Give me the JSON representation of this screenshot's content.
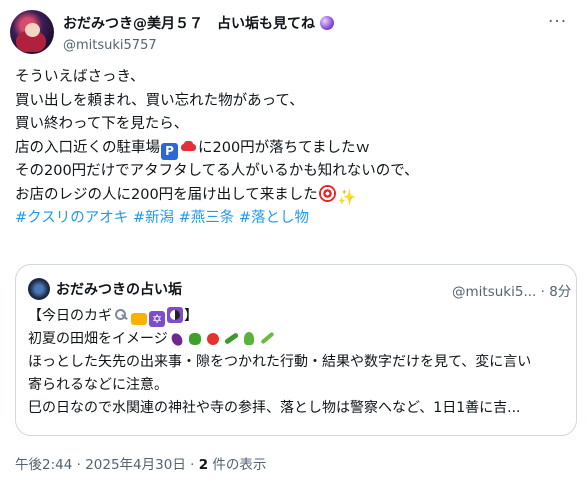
{
  "post": {
    "display_name": "おだみつき@美月５７　占い垢も見てね",
    "handle": "@mitsuki5757",
    "more_label": "···",
    "lines": [
      "そういえばさっき、",
      "買い出しを頼まれ、買い忘れた物があって、",
      "買い終わって下を見たら、",
      "に200円が落ちてましたｗ",
      "その200円だけでアタフタしてる人がいるかも知れないので、",
      "お店のレジの人に200円を届け出して来ました"
    ],
    "line4_prefix": "店の入口近くの駐車場",
    "parking_glyph": "P",
    "hashtags": "#クスリのアオキ #新潟 #燕三条 #落とし物"
  },
  "quote": {
    "name": "おだみつきの占い垢",
    "meta": "@mitsuki5... · 8分",
    "line1_prefix": "【今日のカギ",
    "line1_suffix": "】",
    "line2": "初夏の田畑をイメージ",
    "line3": "ほっとした矢先の出来事・隙をつかれた行動・結果や数字だけを見て、変に言い",
    "line4": "寄られるなどに注意。",
    "line5": "巳の日なので水関連の神社や寺の参拝、落とし物は警察へなど、1日1善に吉..."
  },
  "footer": {
    "timestamp": "午後2:44 · 2025年4月30日 · ",
    "views_count": "2",
    "views_label": " 件の表示"
  },
  "icons": [
    "crystal-ball-icon",
    "parking-icon",
    "car-icon",
    "target-icon",
    "sparkles-icon",
    "key-icon",
    "lock-icon",
    "star-of-david-icon",
    "yin-yang-icon",
    "eggplant-icon",
    "pepper-icon",
    "tomato-icon",
    "cucumber-icon",
    "leafy-green-icon",
    "bean-icon"
  ]
}
